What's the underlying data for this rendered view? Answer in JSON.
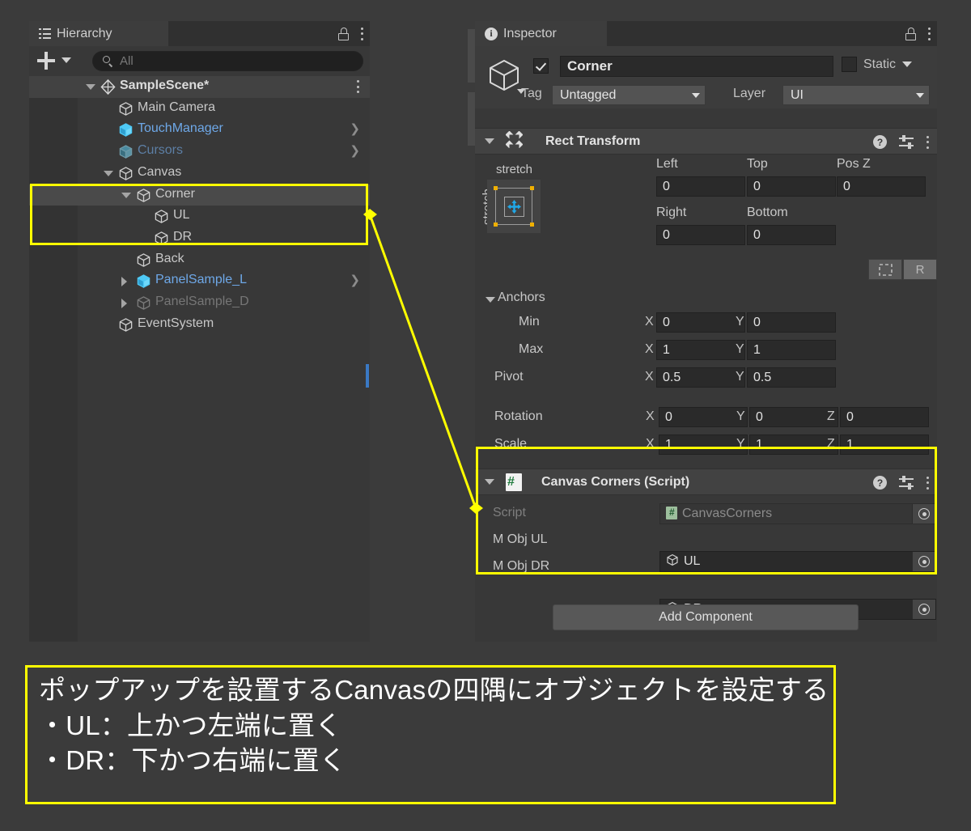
{
  "hierarchy": {
    "tab_label": "Hierarchy",
    "tab_icon": "hierarchy-list-icon",
    "lock_icon": "lock-icon",
    "menu_icon": "kebab-menu-icon",
    "create_label": "+",
    "search_placeholder": "All",
    "search_value": "",
    "items": [
      {
        "label": "SampleScene*",
        "indent": 0,
        "icon": "unity-scene-icon",
        "expanded": true,
        "selected": false,
        "style": "scene",
        "has_menu": true
      },
      {
        "label": "Main Camera",
        "indent": 1,
        "icon": "gameobject-cube-icon",
        "expanded": null,
        "style": "normal"
      },
      {
        "label": "TouchManager",
        "indent": 1,
        "icon": "prefab-cube-icon",
        "expanded": null,
        "style": "prefab",
        "has_chevron": true
      },
      {
        "label": "Cursors",
        "indent": 1,
        "icon": "prefab-cube-icon",
        "expanded": null,
        "style": "prefab-inactive",
        "has_chevron": true
      },
      {
        "label": "Canvas",
        "indent": 1,
        "icon": "gameobject-cube-icon",
        "expanded": true,
        "style": "normal"
      },
      {
        "label": "Corner",
        "indent": 2,
        "icon": "gameobject-cube-icon",
        "expanded": true,
        "style": "normal",
        "selected": true
      },
      {
        "label": "UL",
        "indent": 3,
        "icon": "gameobject-cube-icon",
        "expanded": null,
        "style": "normal"
      },
      {
        "label": "DR",
        "indent": 3,
        "icon": "gameobject-cube-icon",
        "expanded": null,
        "style": "normal"
      },
      {
        "label": "Back",
        "indent": 2,
        "icon": "gameobject-cube-icon",
        "expanded": null,
        "style": "normal"
      },
      {
        "label": "PanelSample_L",
        "indent": 2,
        "icon": "prefab-cube-icon",
        "expanded": false,
        "style": "prefab",
        "has_chevron": true
      },
      {
        "label": "PanelSample_D",
        "indent": 2,
        "icon": "gameobject-cube-icon",
        "expanded": false,
        "style": "inactive"
      },
      {
        "label": "EventSystem",
        "indent": 1,
        "icon": "gameobject-cube-icon",
        "expanded": null,
        "style": "normal"
      }
    ]
  },
  "inspector": {
    "tab_label": "Inspector",
    "tab_icon": "info-icon",
    "lock_icon": "lock-icon",
    "menu_icon": "kebab-menu-icon",
    "object": {
      "enabled": true,
      "name": "Corner",
      "static_label": "Static",
      "static_checked": false,
      "tag_label": "Tag",
      "tag_value": "Untagged",
      "layer_label": "Layer",
      "layer_value": "UI"
    },
    "rect_transform": {
      "title": "Rect Transform",
      "icon": "rect-transform-icon",
      "help_icon": "help-icon",
      "preset_icon": "preset-icon",
      "menu_icon": "kebab-menu-icon",
      "anchor_preset_top": "stretch",
      "anchor_preset_side": "stretch",
      "fields": [
        {
          "label": "Left",
          "value": "0"
        },
        {
          "label": "Top",
          "value": "0"
        },
        {
          "label": "Pos Z",
          "value": "0"
        },
        {
          "label": "Right",
          "value": "0"
        },
        {
          "label": "Bottom",
          "value": "0"
        }
      ],
      "blueprint_label": "",
      "raw_label": "R",
      "anchors_label": "Anchors",
      "rows": [
        {
          "label": "Min",
          "x_label": "X",
          "x": "0",
          "y_label": "Y",
          "y": "0"
        },
        {
          "label": "Max",
          "x_label": "X",
          "x": "1",
          "y_label": "Y",
          "y": "1"
        },
        {
          "label": "Pivot",
          "x_label": "X",
          "x": "0.5",
          "y_label": "Y",
          "y": "0.5"
        }
      ],
      "xyz_rows": [
        {
          "label": "Rotation",
          "x_label": "X",
          "x": "0",
          "y_label": "Y",
          "y": "0",
          "z_label": "Z",
          "z": "0"
        },
        {
          "label": "Scale",
          "x_label": "X",
          "x": "1",
          "y_label": "Y",
          "y": "1",
          "z_label": "Z",
          "z": "1"
        }
      ]
    },
    "canvas_corners": {
      "title": "Canvas Corners (Script)",
      "icon": "cs-script-icon",
      "help_icon": "help-icon",
      "preset_icon": "preset-icon",
      "menu_icon": "kebab-menu-icon",
      "rows": [
        {
          "label": "Script",
          "value": "CanvasCorners",
          "icon": "cs-script-icon",
          "disabled": true
        },
        {
          "label": "M Obj UL",
          "value": "UL",
          "icon": "gameobject-cube-icon",
          "disabled": false
        },
        {
          "label": "M Obj DR",
          "value": "DR",
          "icon": "gameobject-cube-icon",
          "disabled": false
        }
      ]
    },
    "add_component_label": "Add Component"
  },
  "annotations": {
    "highlight_color": "#ffff00",
    "caption_lines": [
      "ポップアップを設置するCanvasの四隅にオブジェクトを設定する",
      "・UL：上かつ左端に置く",
      "・DR：下かつ右端に置く"
    ]
  }
}
